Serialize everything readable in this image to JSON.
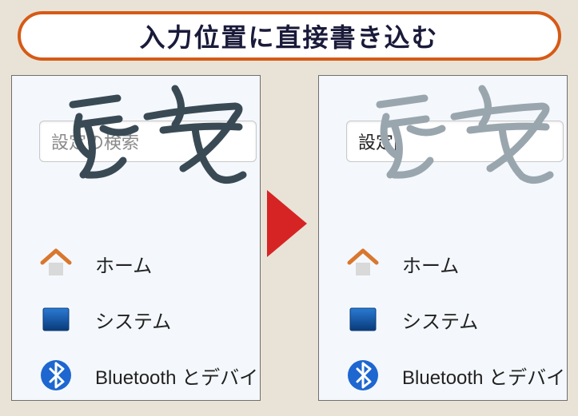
{
  "headline": "入力位置に直接書き込む",
  "handwriting_text": "設定",
  "left": {
    "search": {
      "placeholder": "設定の検索",
      "value": ""
    },
    "items": [
      {
        "icon": "home-icon",
        "label": "ホーム"
      },
      {
        "icon": "system-icon",
        "label": "システム"
      },
      {
        "icon": "bluetooth-icon",
        "label": "Bluetooth とデバイ"
      }
    ]
  },
  "right": {
    "search": {
      "placeholder": "",
      "value": "設定"
    },
    "items": [
      {
        "icon": "home-icon",
        "label": "ホーム"
      },
      {
        "icon": "system-icon",
        "label": "システム"
      },
      {
        "icon": "bluetooth-icon",
        "label": "Bluetooth とデバイ"
      }
    ]
  },
  "icons": {
    "home-icon": "home",
    "system-icon": "system",
    "bluetooth-icon": "bluetooth"
  }
}
